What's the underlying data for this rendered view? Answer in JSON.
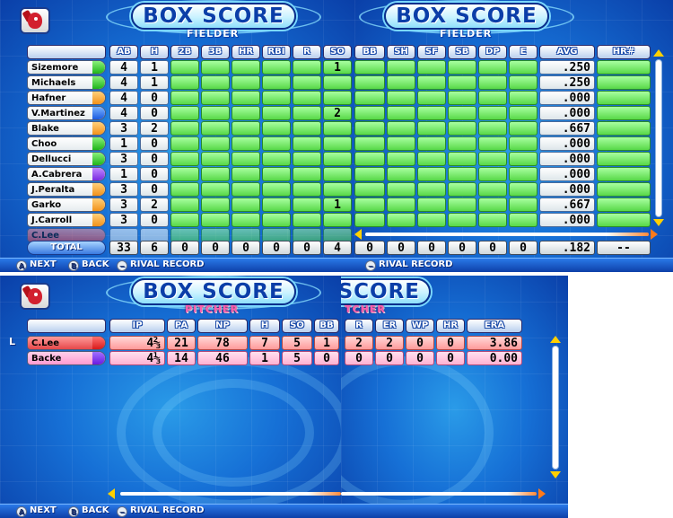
{
  "screen": {
    "title": "BOX SCORE",
    "fielder_subtitle": "FIELDER",
    "pitcher_subtitle": "PITCHER",
    "pitcher_title_partial": "SCORE",
    "pitcher_subtitle_partial": "TCHER"
  },
  "fielder_left": {
    "headers": [
      "AB",
      "H",
      "2B",
      "3B",
      "HR",
      "RBI",
      "R",
      "SO"
    ],
    "players": [
      {
        "name": "Sizemore",
        "tab": "green",
        "AB": "4",
        "H": "1",
        "SO": "1"
      },
      {
        "name": "Michaels",
        "tab": "green",
        "AB": "4",
        "H": "1",
        "SO": ""
      },
      {
        "name": "Hafner",
        "tab": "orange",
        "AB": "4",
        "H": "0",
        "SO": ""
      },
      {
        "name": "V.Martinez",
        "tab": "blue",
        "AB": "4",
        "H": "0",
        "SO": "2"
      },
      {
        "name": "Blake",
        "tab": "orange",
        "AB": "3",
        "H": "2",
        "SO": ""
      },
      {
        "name": "Choo",
        "tab": "green",
        "AB": "1",
        "H": "0",
        "SO": ""
      },
      {
        "name": "Dellucci",
        "tab": "green",
        "AB": "3",
        "H": "0",
        "SO": ""
      },
      {
        "name": "A.Cabrera",
        "tab": "purple",
        "AB": "1",
        "H": "0",
        "SO": ""
      },
      {
        "name": "J.Peralta",
        "tab": "orange",
        "AB": "3",
        "H": "0",
        "SO": ""
      },
      {
        "name": "Garko",
        "tab": "orange",
        "AB": "3",
        "H": "2",
        "SO": "1"
      },
      {
        "name": "J.Carroll",
        "tab": "orange",
        "AB": "3",
        "H": "0",
        "SO": ""
      },
      {
        "name": "C.Lee",
        "tab": "red",
        "AB": "",
        "H": "",
        "SO": ""
      }
    ],
    "total_label": "TOTAL",
    "totals": [
      "33",
      "6",
      "0",
      "0",
      "0",
      "0",
      "0",
      "4"
    ]
  },
  "fielder_right": {
    "headers": [
      "BB",
      "SH",
      "SF",
      "SB",
      "DP",
      "E",
      "AVG",
      "HR#"
    ],
    "avgs": [
      ".250",
      ".250",
      ".000",
      ".000",
      ".667",
      ".000",
      ".000",
      ".000",
      ".000",
      ".667",
      ".000"
    ],
    "totals": [
      "0",
      "0",
      "0",
      "0",
      "0",
      "0",
      ".182",
      "--"
    ]
  },
  "pitcher_left": {
    "headers": [
      "IP",
      "PA",
      "NP",
      "H",
      "SO",
      "BB"
    ],
    "rows": [
      {
        "name": "C.Lee",
        "style": "red",
        "IP": "4⅔",
        "PA": "21",
        "NP": "78",
        "H": "7",
        "SO": "5",
        "BB": "1"
      },
      {
        "name": "Backe",
        "style": "pink",
        "IP": "4⅓",
        "PA": "14",
        "NP": "46",
        "H": "1",
        "SO": "5",
        "BB": "0"
      }
    ],
    "marker": "L"
  },
  "pitcher_right": {
    "headers": [
      "R",
      "ER",
      "WP",
      "HR",
      "ERA"
    ],
    "rows": [
      {
        "R": "2",
        "ER": "2",
        "WP": "0",
        "HR": "0",
        "ERA": "3.86"
      },
      {
        "R": "0",
        "ER": "0",
        "WP": "0",
        "HR": "0",
        "ERA": "0.00"
      }
    ]
  },
  "hints": {
    "next": "NEXT",
    "back": "BACK",
    "rival": "RIVAL RECORD",
    "btn_a": "A",
    "btn_b": "B",
    "btn_minus": "−"
  }
}
